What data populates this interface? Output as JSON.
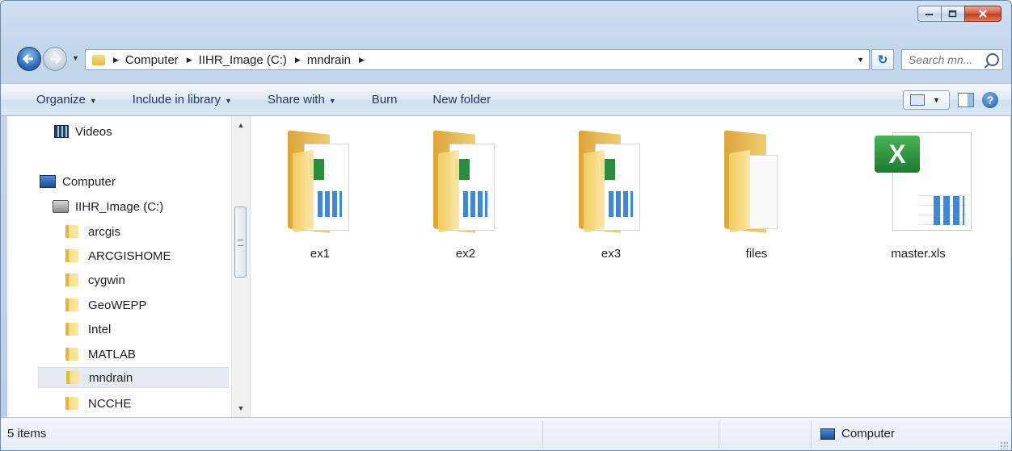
{
  "address": {
    "crumbs": [
      "Computer",
      "IIHR_Image (C:)",
      "mndrain"
    ]
  },
  "search": {
    "placeholder": "Search mn..."
  },
  "toolbar": {
    "organize": "Organize",
    "include_in_library": "Include in library",
    "share_with": "Share with",
    "burn": "Burn",
    "new_folder": "New folder",
    "help": "?"
  },
  "nav": {
    "videos": "Videos",
    "computer": "Computer",
    "drive": "IIHR_Image (C:)",
    "folders": [
      "arcgis",
      "ARCGISHOME",
      "cygwin",
      "GeoWEPP",
      "Intel",
      "MATLAB",
      "mndrain",
      "NCCHE"
    ],
    "selected": "mndrain"
  },
  "files": [
    {
      "name": "ex1",
      "icon": "excel-folder-icon"
    },
    {
      "name": "ex2",
      "icon": "excel-folder-icon"
    },
    {
      "name": "ex3",
      "icon": "excel-folder-icon"
    },
    {
      "name": "files",
      "icon": "folder-icon"
    },
    {
      "name": "master.xls",
      "icon": "excel-file-icon"
    }
  ],
  "status": {
    "count": "5 items",
    "zone": "Computer"
  },
  "colors": {
    "accent": "#1e395b",
    "selection": "#e5eaf0",
    "close_button": "#c43a1f"
  }
}
